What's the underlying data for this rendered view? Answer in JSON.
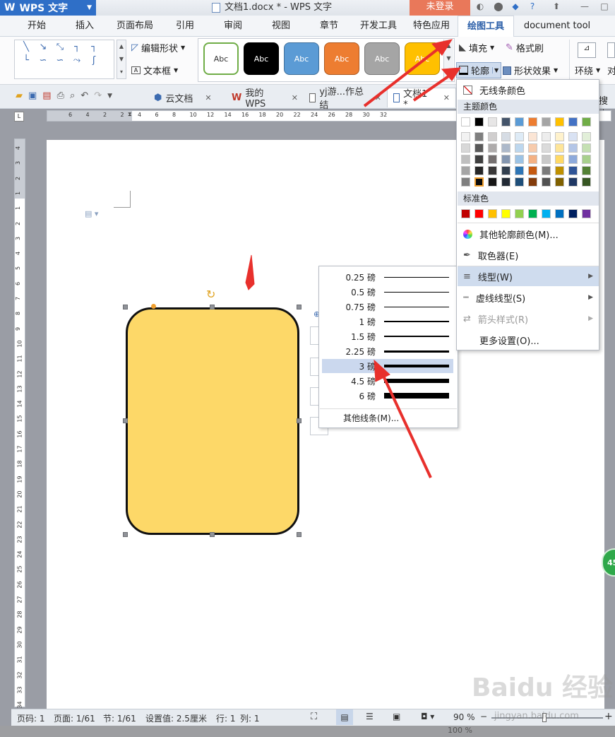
{
  "app": {
    "name": "WPS 文字",
    "doc_title": "文档1.docx * - WPS 文字",
    "login": "未登录"
  },
  "menu": {
    "tabs": [
      "开始",
      "插入",
      "页面布局",
      "引用",
      "审阅",
      "视图",
      "章节",
      "开发工具",
      "特色应用",
      "绘图工具",
      "document tool"
    ]
  },
  "ribbon": {
    "edit_shape": "编辑形状",
    "text_box": "文本框",
    "style_label": "Abc",
    "fill": "填充",
    "format_painter": "格式刷",
    "outline": "轮廓",
    "shape_effect": "形状效果",
    "wrap": "环绕",
    "align": "对"
  },
  "doc_tabs": [
    {
      "label": "云文档"
    },
    {
      "label": "我的WPS"
    },
    {
      "label": "yj游...作总结"
    },
    {
      "label": "文档1 *"
    }
  ],
  "search_label": "搜索",
  "ruler_h": [
    "6",
    "4",
    "2",
    "2",
    "4",
    "6",
    "8",
    "10",
    "12",
    "14",
    "16",
    "18",
    "20",
    "22",
    "24",
    "26",
    "28",
    "30",
    "32"
  ],
  "ruler_v": [
    "4",
    "3",
    "2",
    "1",
    "1",
    "2",
    "3",
    "4",
    "5",
    "6",
    "7",
    "8",
    "9",
    "10",
    "11",
    "12",
    "13",
    "14",
    "15",
    "16",
    "17",
    "18",
    "19",
    "20",
    "21",
    "22",
    "23",
    "24",
    "25",
    "26",
    "27",
    "28",
    "29",
    "30",
    "31",
    "32",
    "33",
    "34"
  ],
  "outline_menu": {
    "no_line": "无线条颜色",
    "theme_colors": "主题颜色",
    "standard_colors": "标准色",
    "more_colors": "其他轮廓颜色(M)...",
    "eyedropper": "取色器(E)",
    "line_type": "线型(W)",
    "dash_type": "虚线线型(S)",
    "arrow_style": "箭头样式(R)",
    "more_settings": "更多设置(O)..."
  },
  "theme_palette": {
    "top": [
      "#ffffff",
      "#000000",
      "#e7e6e6",
      "#44546a",
      "#5b9bd5",
      "#ed7d31",
      "#a5a5a5",
      "#ffc000",
      "#4472c4",
      "#70ad47"
    ],
    "shades": [
      [
        "#f2f2f2",
        "#7f7f7f",
        "#d0cece",
        "#d6dce4",
        "#deebf6",
        "#fbe5d5",
        "#ededed",
        "#fff2cc",
        "#d9e2f3",
        "#e2efd9"
      ],
      [
        "#d8d8d8",
        "#595959",
        "#aeabab",
        "#adb9ca",
        "#bdd7ee",
        "#f7cbac",
        "#dbdbdb",
        "#fee599",
        "#b4c6e7",
        "#c5e0b3"
      ],
      [
        "#bfbfbf",
        "#3f3f3f",
        "#757070",
        "#8496b0",
        "#9cc3e5",
        "#f4b183",
        "#c9c9c9",
        "#ffd965",
        "#8eaadb",
        "#a8d08d"
      ],
      [
        "#a5a5a5",
        "#262626",
        "#3a3838",
        "#323f4f",
        "#2e75b5",
        "#c55a11",
        "#7b7b7b",
        "#bf9000",
        "#2f5496",
        "#538135"
      ],
      [
        "#7f7f7f",
        "#0c0c0c",
        "#171616",
        "#222a35",
        "#1e4e79",
        "#833c0b",
        "#525252",
        "#7f6000",
        "#1f3864",
        "#375623"
      ]
    ],
    "standard": [
      "#c00000",
      "#ff0000",
      "#ffc000",
      "#ffff00",
      "#92d050",
      "#00b050",
      "#00b0f0",
      "#0070c0",
      "#002060",
      "#7030a0"
    ]
  },
  "line_weights": [
    {
      "label": "0.25 磅"
    },
    {
      "label": "0.5 磅"
    },
    {
      "label": "0.75 磅"
    },
    {
      "label": "1 磅"
    },
    {
      "label": "1.5 磅"
    },
    {
      "label": "2.25 磅"
    },
    {
      "label": "3 磅",
      "selected": true
    },
    {
      "label": "4.5 磅"
    },
    {
      "label": "6 磅"
    }
  ],
  "more_lines": "其他线条(M)...",
  "status": {
    "page_num": "页码: 1",
    "page": "页面: 1/61",
    "section": "节: 1/61",
    "setting": "设置值: 2.5厘米",
    "row": "行: 1",
    "col": "列: 1",
    "zoom": "90 %",
    "zoom2": "100 %",
    "badge": "45"
  },
  "watermark": {
    "text": "Baidu 经验",
    "url": "jingyan.baidu.com"
  }
}
